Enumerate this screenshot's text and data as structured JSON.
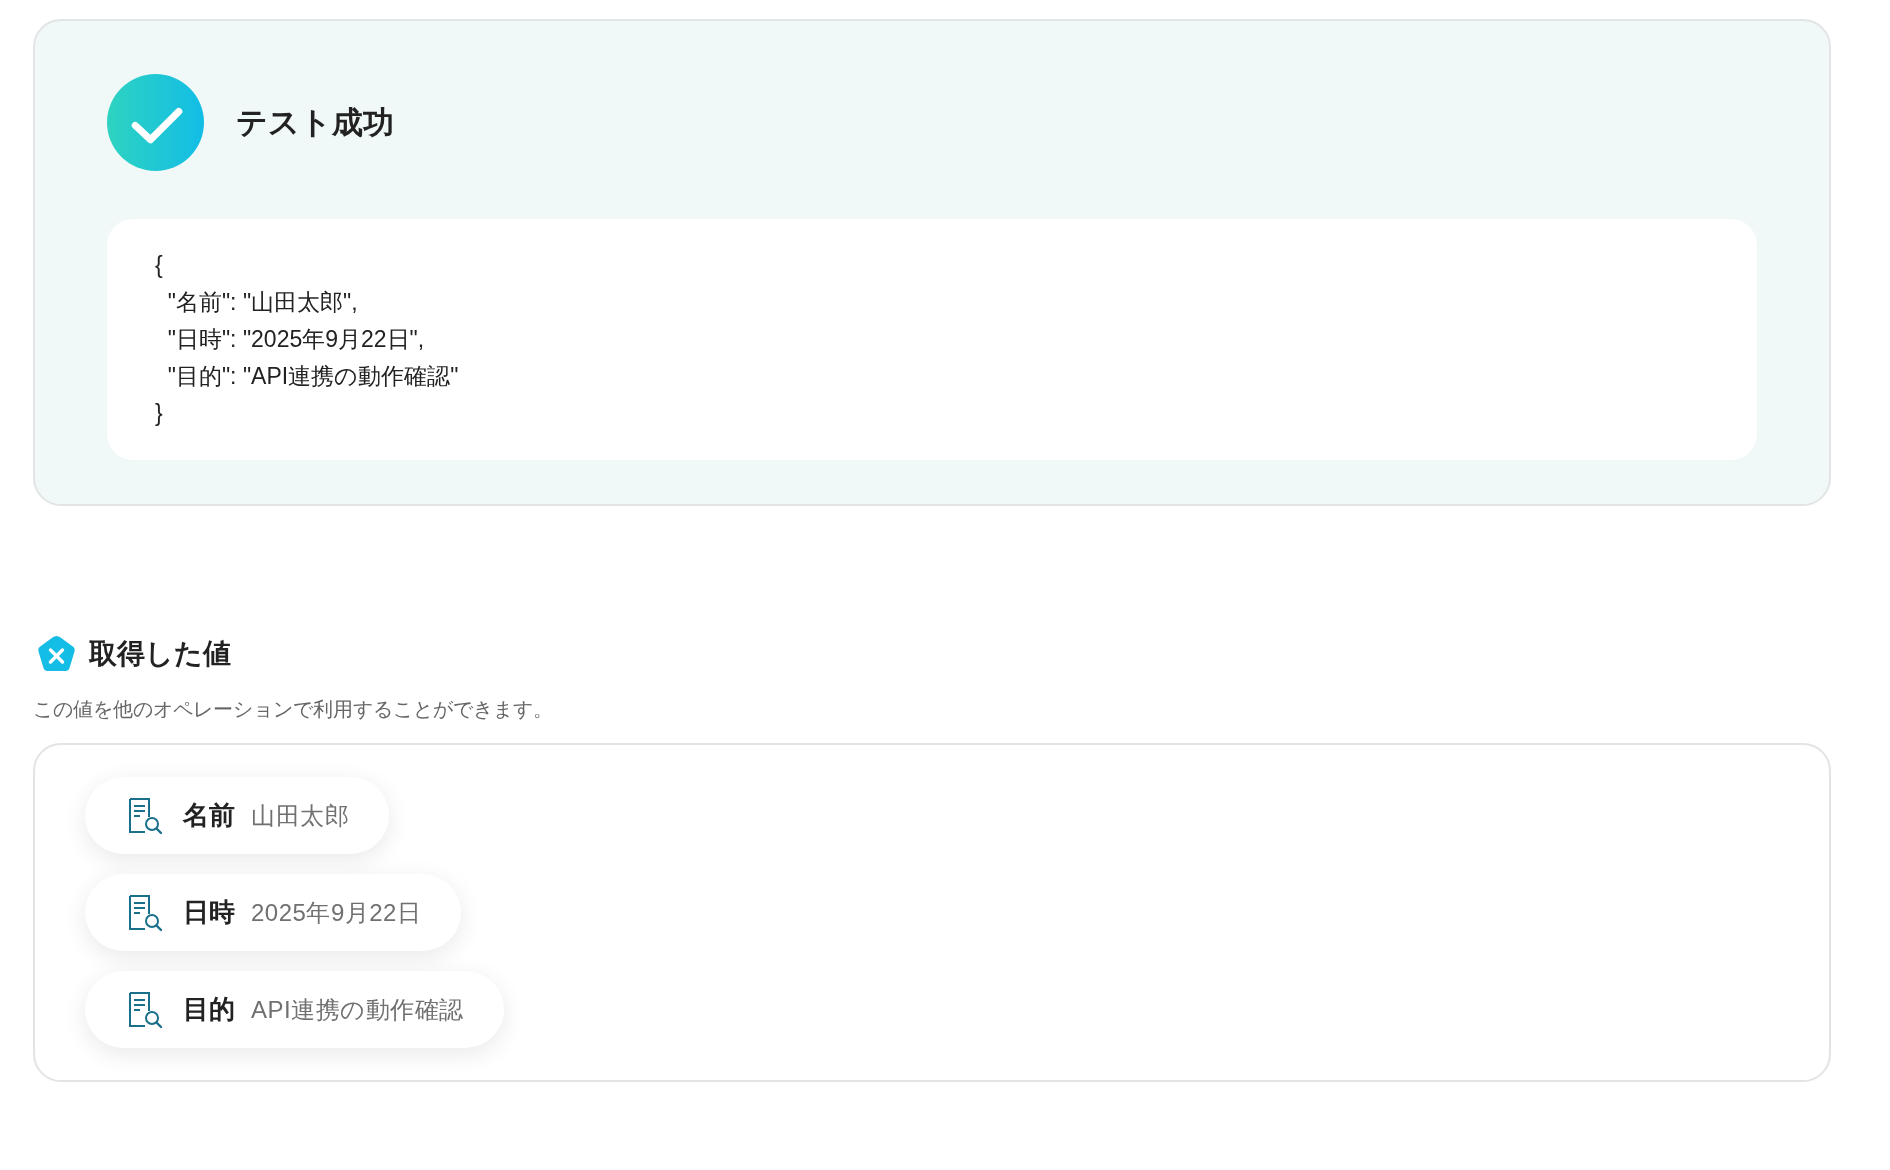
{
  "result": {
    "title": "テスト成功",
    "code_lines": [
      "{",
      "  \"名前\": \"山田太郎\",",
      "  \"日時\": \"2025年9月22日\",",
      "  \"目的\": \"API連携の動作確認\"",
      "}"
    ]
  },
  "values_section": {
    "title": "取得した値",
    "description": "この値を他のオペレーションで利用することができます。",
    "items": [
      {
        "label": "名前",
        "value": "山田太郎"
      },
      {
        "label": "日時",
        "value": "2025年9月22日"
      },
      {
        "label": "目的",
        "value": "API連携の動作確認"
      }
    ]
  }
}
